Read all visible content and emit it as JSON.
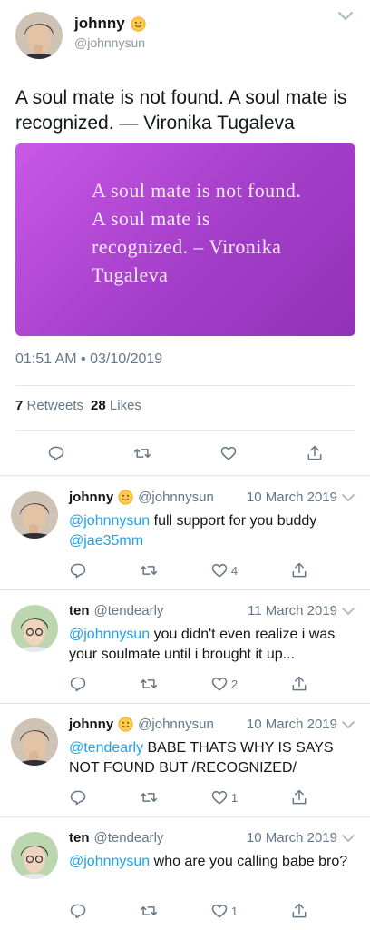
{
  "main_tweet": {
    "name": "johnny",
    "name_emoji": "smiling-face-emoji",
    "handle": "@johnnysun",
    "text": "A soul mate is not found. A soul mate is recognized. — Vironika Tugaleva",
    "media_text": "A soul mate is not found. A soul mate is recognized.  –  Vironika Tugaleva",
    "timestamp": "01:51 AM • 03/10/2019",
    "retweets_count": "7",
    "retweets_label": "Retweets",
    "likes_count": "28",
    "likes_label": "Likes"
  },
  "replies": [
    {
      "name": "johnny",
      "has_emoji": true,
      "handle": "@johnnysun",
      "date": "10 March 2019",
      "mention": "@johnnysun",
      "text": " full support for you buddy ",
      "mention2": "@jae35mm",
      "like_count": "4"
    },
    {
      "name": "ten",
      "has_emoji": false,
      "handle": "@tendearly",
      "date": "11 March 2019",
      "mention": "@johnnysun",
      "text": " you didn't even realize i was your soulmate until i brought it up...",
      "mention2": "",
      "like_count": "2"
    },
    {
      "name": "johnny",
      "has_emoji": true,
      "handle": "@johnnysun",
      "date": "10 March 2019",
      "mention": "@tendearly",
      "text": " BABE THATS WHY IS SAYS NOT FOUND BUT /RECOGNIZED/",
      "mention2": "",
      "like_count": "1"
    },
    {
      "name": "ten",
      "has_emoji": false,
      "handle": "@tendearly",
      "date": "10 March 2019",
      "mention": "@johnnysun",
      "text": " who are you calling babe bro?",
      "mention2": "",
      "like_count": "1"
    }
  ],
  "colors": {
    "accent": "#1da1f2",
    "media_gradient_start": "#c958e6",
    "media_gradient_end": "#9232b8",
    "secondary_text": "#657786",
    "divider": "#e1e8ed"
  },
  "icons": [
    "reply-icon",
    "retweet-icon",
    "like-icon",
    "share-icon",
    "chevron-down-icon",
    "smiling-face-emoji"
  ]
}
